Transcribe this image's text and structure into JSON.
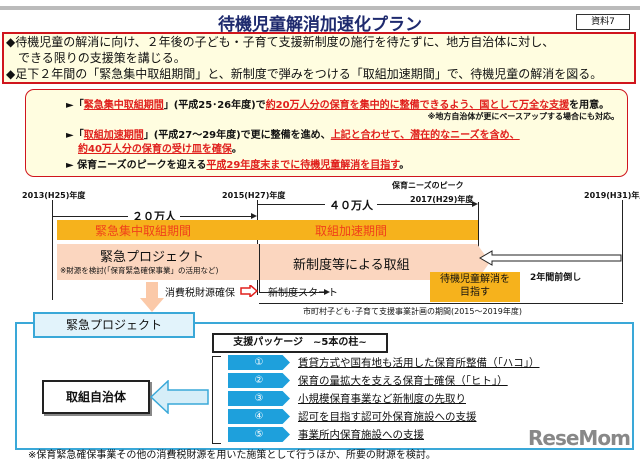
{
  "title": "待機児童解消加速化プラン",
  "badge": "資料7",
  "lead": [
    "◆待機児童の解消に向け、２年後の子ども・子育て支援新制度の施行を待たずに、地方自治体に対し、",
    "　できる限りの支援策を講じる。",
    "◆足下２年間の「緊急集中取組期間」と、新制度で弾みをつける「取組加速期間」で、待機児童の解消を図る。"
  ],
  "points": {
    "p1a": "►「",
    "p1b": "緊急集中取組期間",
    "p1c": "」(平成25･26年度)で",
    "p1d": "約20万人分の保育を集中的に整備できるよう、国として万全な支援",
    "p1e": "を用意。",
    "note": "※地方自治体が更にペースアップする場合にも対応。",
    "p2a": "►「",
    "p2b": "取組加速期間",
    "p2c": "」(平成27～29年度)で更に整備を進め、",
    "p2d": "上記と合わせて、潜在的なニーズを含め、",
    "p2e": "約40万人分の保育の受け皿を確保",
    "p2f": "。",
    "p3a": "► 保育ニーズのピークを迎える",
    "p3b": "平成29年度末までに待機児童解消を目指す",
    "p3c": "。"
  },
  "timeline": {
    "y2013": "2013(H25)年度",
    "y2015": "2015(H27)年度",
    "peak": "保育ニーズのピーク",
    "y2017": "2017(H29)年度",
    "y2019": "2019(H31)年度",
    "n20": "２０万人",
    "n40": "４０万人",
    "period1": "緊急集中取組期間",
    "period2": "取組加速期間",
    "proj": "緊急プロジェクト",
    "proj_note": "※財源を検討(「保育緊急確保事業」の活用など)",
    "newsys": "新制度等による取組",
    "advance": "2年間前倒し",
    "goal1": "待機児童解消を",
    "goal2": "目指す",
    "tax": "消費税財源確保",
    "start": "新制度スタート",
    "plan": "市町村子ども･子育て支援事業計画の期間(2015～2019年度)"
  },
  "lower": {
    "tab": "緊急プロジェクト",
    "package": "支援パッケージ　~5本の柱~",
    "target": "取組自治体",
    "items": [
      {
        "n": "①",
        "t": "賃貸方式や国有地も活用した保育所整備（「ハコ」）"
      },
      {
        "n": "②",
        "t": "保育の量拡大を支える保育士確保（「ヒト」）"
      },
      {
        "n": "③",
        "t": "小規模保育事業など新制度の先取り"
      },
      {
        "n": "④",
        "t": "認可を目指す認可外保育施設への支援"
      },
      {
        "n": "⑤",
        "t": "事業所内保育施設への支援"
      }
    ],
    "footnote": "※保育緊急確保事業その他の消費税財源を用いた施策として行うほか、所要の財源を検討。"
  },
  "logo": "ReseMom"
}
